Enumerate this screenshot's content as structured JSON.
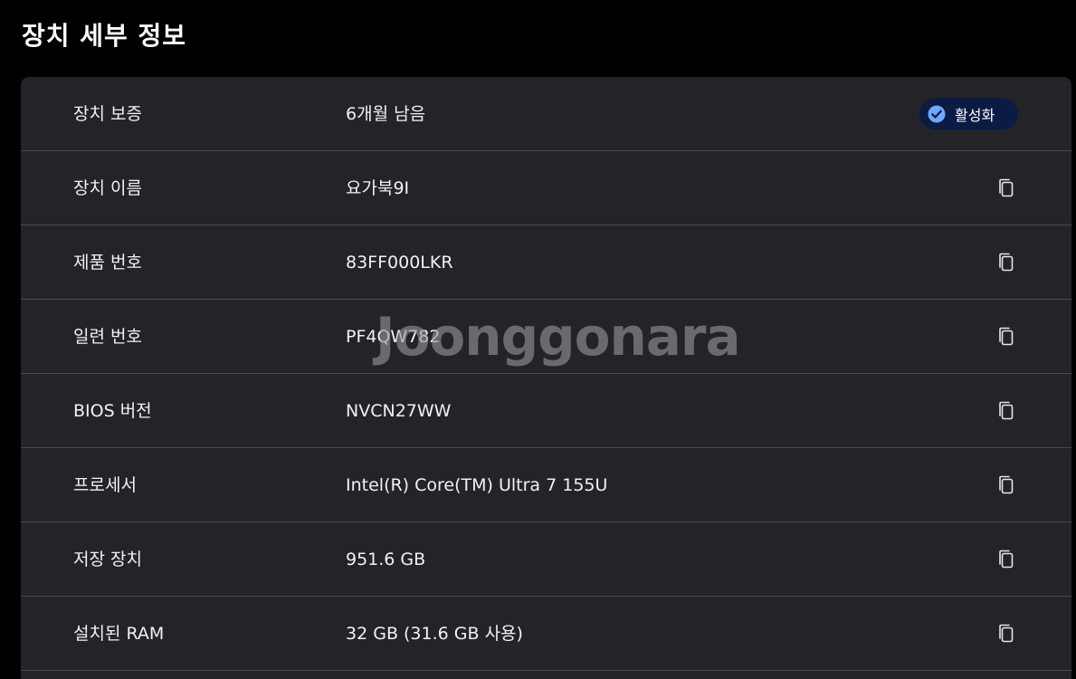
{
  "page": {
    "title": "장치 세부 정보"
  },
  "rows": [
    {
      "label": "장치 보증",
      "value": "6개월 남음"
    },
    {
      "label": "장치 이름",
      "value": "요가북9I"
    },
    {
      "label": "제품 번호",
      "value": "83FF000LKR"
    },
    {
      "label": "일련 번호",
      "value": "PF4QW782"
    },
    {
      "label": "BIOS 버전",
      "value": "NVCN27WW"
    },
    {
      "label": "프로세서",
      "value": "Intel(R) Core(TM) Ultra 7 155U"
    },
    {
      "label": "저장 장치",
      "value": "951.6 GB"
    },
    {
      "label": "설치된 RAM",
      "value": "32 GB (31.6 GB 사용)"
    }
  ],
  "warranty_badge": {
    "label": "활성화",
    "icon": "check-circle-icon",
    "bg_color": "#0b1b44",
    "icon_color": "#6ea8ff"
  },
  "copy_icon": "copy-icon",
  "watermark": {
    "text": "Joonggonara"
  },
  "colors": {
    "background": "#000000",
    "panel": "#232328",
    "divider": "#4a4a50",
    "text": "#f2f2f2"
  }
}
